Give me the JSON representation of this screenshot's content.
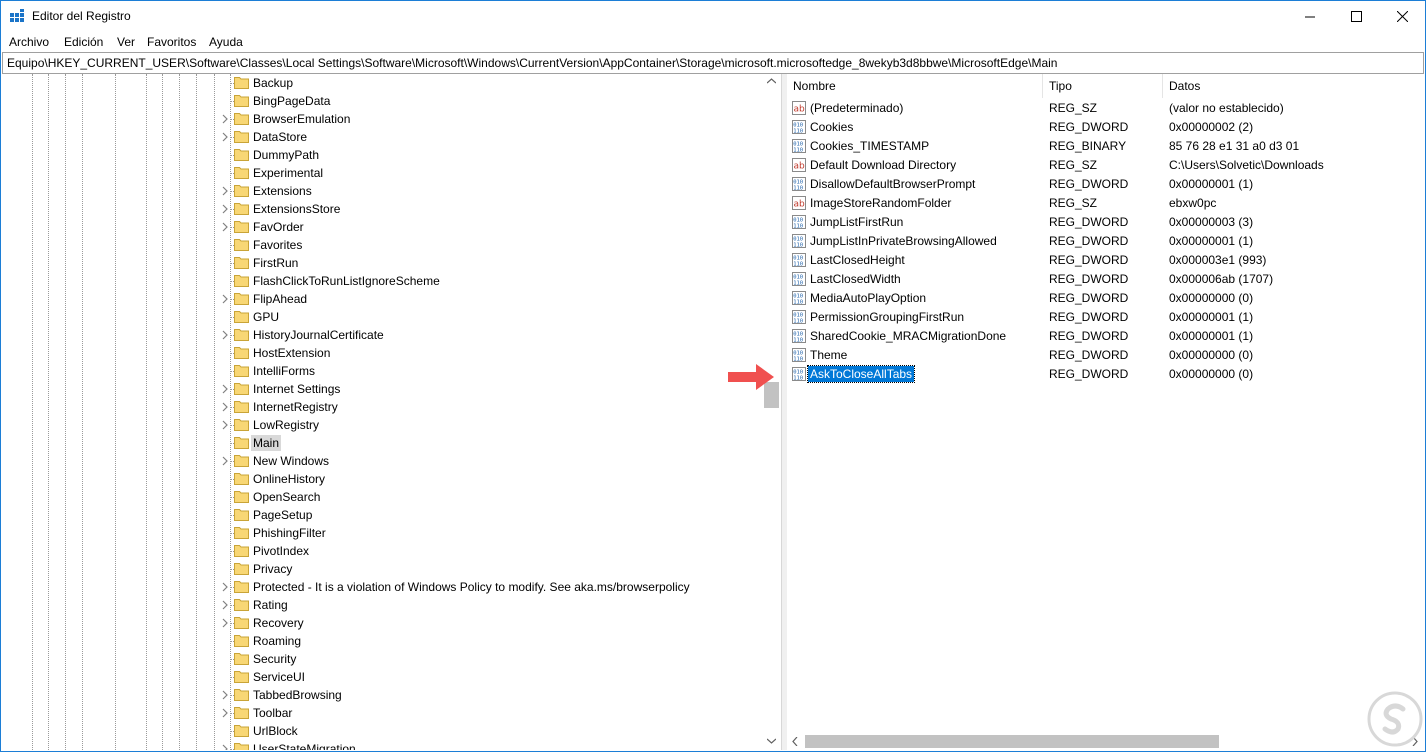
{
  "window": {
    "title": "Editor del Registro"
  },
  "menu": [
    "Archivo",
    "Edición",
    "Ver",
    "Favoritos",
    "Ayuda"
  ],
  "address": "Equipo\\HKEY_CURRENT_USER\\Software\\Classes\\Local Settings\\Software\\Microsoft\\Windows\\CurrentVersion\\AppContainer\\Storage\\microsoft.microsoftedge_8wekyb3d8bbwe\\MicrosoftEdge\\Main",
  "tree": [
    {
      "label": "Backup",
      "expandable": false
    },
    {
      "label": "BingPageData",
      "expandable": false
    },
    {
      "label": "BrowserEmulation",
      "expandable": true
    },
    {
      "label": "DataStore",
      "expandable": true
    },
    {
      "label": "DummyPath",
      "expandable": false
    },
    {
      "label": "Experimental",
      "expandable": false
    },
    {
      "label": "Extensions",
      "expandable": true
    },
    {
      "label": "ExtensionsStore",
      "expandable": true
    },
    {
      "label": "FavOrder",
      "expandable": true
    },
    {
      "label": "Favorites",
      "expandable": false
    },
    {
      "label": "FirstRun",
      "expandable": false
    },
    {
      "label": "FlashClickToRunListIgnoreScheme",
      "expandable": false
    },
    {
      "label": "FlipAhead",
      "expandable": true
    },
    {
      "label": "GPU",
      "expandable": false
    },
    {
      "label": "HistoryJournalCertificate",
      "expandable": true
    },
    {
      "label": "HostExtension",
      "expandable": false
    },
    {
      "label": "IntelliForms",
      "expandable": false
    },
    {
      "label": "Internet Settings",
      "expandable": true
    },
    {
      "label": "InternetRegistry",
      "expandable": true
    },
    {
      "label": "LowRegistry",
      "expandable": true
    },
    {
      "label": "Main",
      "expandable": false,
      "selected": true
    },
    {
      "label": "New Windows",
      "expandable": true
    },
    {
      "label": "OnlineHistory",
      "expandable": false
    },
    {
      "label": "OpenSearch",
      "expandable": false
    },
    {
      "label": "PageSetup",
      "expandable": false
    },
    {
      "label": "PhishingFilter",
      "expandable": false
    },
    {
      "label": "PivotIndex",
      "expandable": false
    },
    {
      "label": "Privacy",
      "expandable": false
    },
    {
      "label": "Protected - It is a violation of Windows Policy to modify. See aka.ms/browserpolicy",
      "expandable": true
    },
    {
      "label": "Rating",
      "expandable": true
    },
    {
      "label": "Recovery",
      "expandable": true
    },
    {
      "label": "Roaming",
      "expandable": false
    },
    {
      "label": "Security",
      "expandable": false
    },
    {
      "label": "ServiceUI",
      "expandable": false
    },
    {
      "label": "TabbedBrowsing",
      "expandable": true
    },
    {
      "label": "Toolbar",
      "expandable": true
    },
    {
      "label": "UrlBlock",
      "expandable": false
    },
    {
      "label": "UserStateMigration",
      "expandable": true
    }
  ],
  "columns": [
    "Nombre",
    "Tipo",
    "Datos"
  ],
  "values": [
    {
      "name": "(Predeterminado)",
      "type": "REG_SZ",
      "data": "(valor no establecido)",
      "icon": "string-value-icon"
    },
    {
      "name": "Cookies",
      "type": "REG_DWORD",
      "data": "0x00000002 (2)",
      "icon": "binary-value-icon"
    },
    {
      "name": "Cookies_TIMESTAMP",
      "type": "REG_BINARY",
      "data": "85 76 28 e1 31 a0 d3 01",
      "icon": "binary-value-icon"
    },
    {
      "name": "Default Download Directory",
      "type": "REG_SZ",
      "data": "C:\\Users\\Solvetic\\Downloads",
      "icon": "string-value-icon"
    },
    {
      "name": "DisallowDefaultBrowserPrompt",
      "type": "REG_DWORD",
      "data": "0x00000001 (1)",
      "icon": "binary-value-icon"
    },
    {
      "name": "ImageStoreRandomFolder",
      "type": "REG_SZ",
      "data": "ebxw0pc",
      "icon": "string-value-icon"
    },
    {
      "name": "JumpListFirstRun",
      "type": "REG_DWORD",
      "data": "0x00000003 (3)",
      "icon": "binary-value-icon"
    },
    {
      "name": "JumpListInPrivateBrowsingAllowed",
      "type": "REG_DWORD",
      "data": "0x00000001 (1)",
      "icon": "binary-value-icon"
    },
    {
      "name": "LastClosedHeight",
      "type": "REG_DWORD",
      "data": "0x000003e1 (993)",
      "icon": "binary-value-icon"
    },
    {
      "name": "LastClosedWidth",
      "type": "REG_DWORD",
      "data": "0x000006ab (1707)",
      "icon": "binary-value-icon"
    },
    {
      "name": "MediaAutoPlayOption",
      "type": "REG_DWORD",
      "data": "0x00000000 (0)",
      "icon": "binary-value-icon"
    },
    {
      "name": "PermissionGroupingFirstRun",
      "type": "REG_DWORD",
      "data": "0x00000001 (1)",
      "icon": "binary-value-icon"
    },
    {
      "name": "SharedCookie_MRACMigrationDone",
      "type": "REG_DWORD",
      "data": "0x00000001 (1)",
      "icon": "binary-value-icon"
    },
    {
      "name": "Theme",
      "type": "REG_DWORD",
      "data": "0x00000000 (0)",
      "icon": "binary-value-icon"
    },
    {
      "name": "AskToCloseAllTabs",
      "type": "REG_DWORD",
      "data": "0x00000000 (0)",
      "icon": "binary-value-icon",
      "selected": true
    }
  ],
  "colors": {
    "selection": "#0078d7",
    "tree_selection": "#d9d9d9",
    "callout_arrow": "#f0504f",
    "folder": "#f8d775"
  }
}
